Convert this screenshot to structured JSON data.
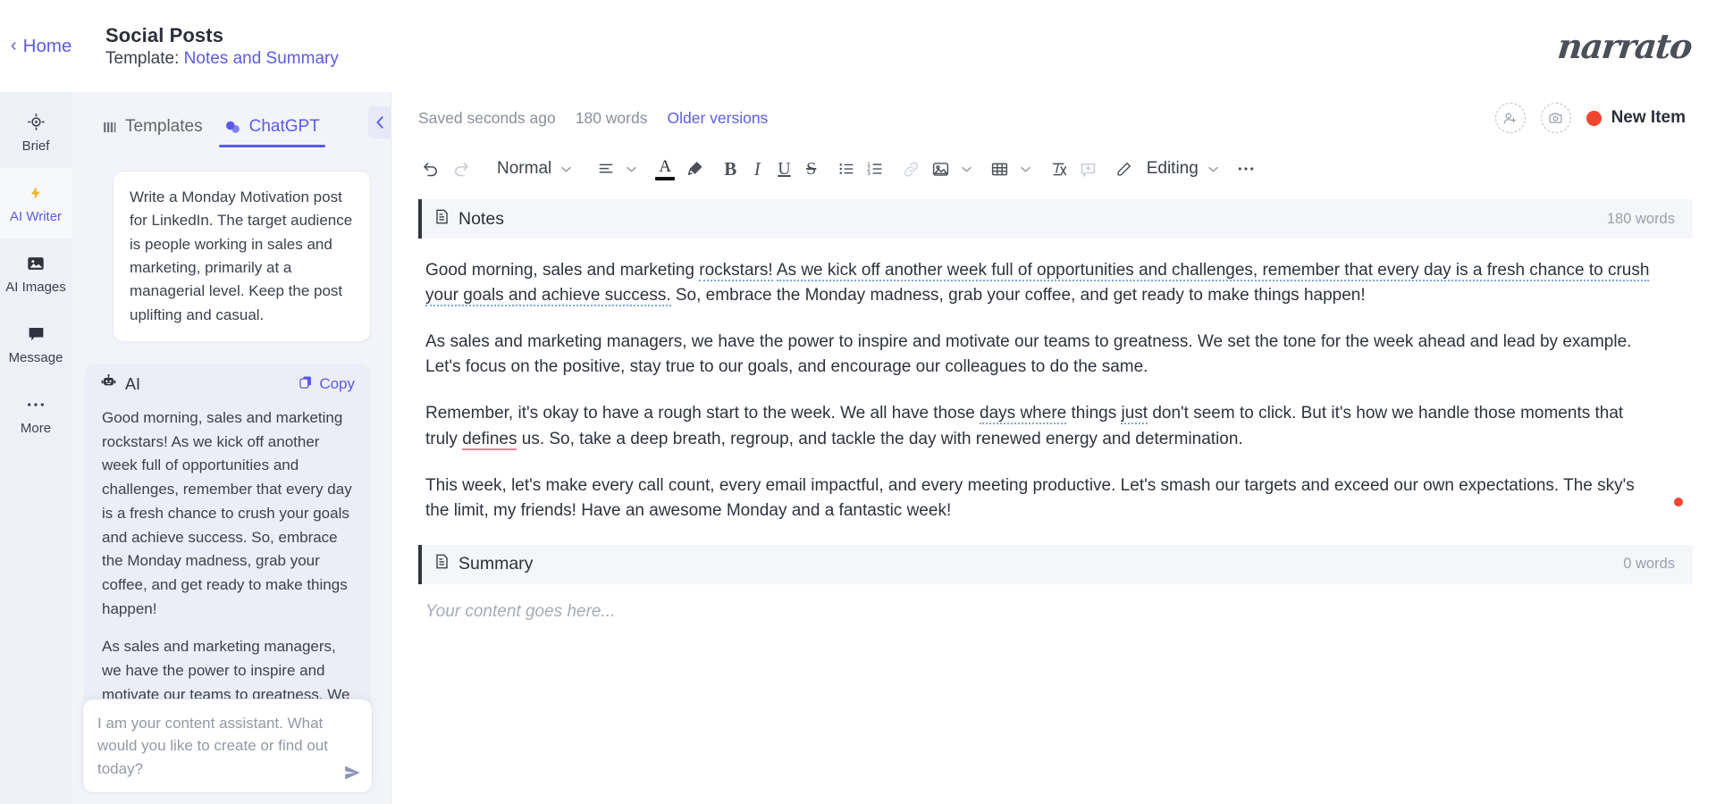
{
  "header": {
    "home_label": "Home",
    "doc_title": "Social Posts",
    "template_prefix": "Template:",
    "template_name": "Notes and Summary",
    "brand": "narrato"
  },
  "rail": {
    "items": [
      {
        "label": "Brief",
        "icon": "target-icon",
        "active": false
      },
      {
        "label": "AI Writer",
        "icon": "lightning-icon",
        "active": true
      },
      {
        "label": "AI Images",
        "icon": "image-icon",
        "active": false
      },
      {
        "label": "Message",
        "icon": "chat-bubble-icon",
        "active": false
      },
      {
        "label": "More",
        "icon": "ellipsis-icon",
        "active": false
      }
    ]
  },
  "panel": {
    "tabs": [
      {
        "label": "Templates",
        "icon": "templates-icon",
        "active": false
      },
      {
        "label": "ChatGPT",
        "icon": "chat-dots-icon",
        "active": true
      }
    ],
    "user_prompt": "Write a Monday Motivation post for LinkedIn. The target audience is people working in sales and marketing, primarily at a managerial level. Keep the post uplifting and casual.",
    "ai_label": "AI",
    "copy_label": "Copy",
    "ai_response_paragraphs": [
      "Good morning, sales and marketing rockstars! As we kick off another week full of opportunities and challenges, remember that every day is a fresh chance to crush your goals and achieve success. So, embrace the Monday madness, grab your coffee, and get ready to make things happen!",
      "As sales and marketing managers, we have the power to inspire and motivate our teams to greatness. We set the tone for the week ahead and lead by example."
    ],
    "chat_placeholder": "I am your content assistant. What would you like to create or find out today?"
  },
  "editor": {
    "saved_status": "Saved seconds ago",
    "word_count": "180 words",
    "older_versions": "Older versions",
    "new_item_label": "New Item",
    "new_item_dot_color": "#f0452e",
    "toolbar": {
      "style_label": "Normal",
      "editing_label": "Editing"
    },
    "sections": [
      {
        "title": "Notes",
        "words": "180 words",
        "paragraphs": [
          [
            {
              "t": "Good morning, sales and marketing ",
              "u": "none"
            },
            {
              "t": "rockstars!",
              "u": "blue"
            },
            {
              "t": " ",
              "u": "none"
            },
            {
              "t": "As we kick off another week full of opportunities and challenges, remember that every day is a fresh chance to crush your goals and achieve success.",
              "u": "blue"
            },
            {
              "t": " So, embrace the Monday madness, grab your coffee, and get ready to make things happen!",
              "u": "none"
            }
          ],
          [
            {
              "t": "As sales and marketing managers, we have the power to inspire and motivate our teams to greatness. We set the tone for the week ahead and lead by example. Let's focus on the positive, stay true to our goals, and encourage our colleagues to do the same.",
              "u": "none"
            }
          ],
          [
            {
              "t": "Remember, it's okay to have a rough start to the week. We all have those ",
              "u": "none"
            },
            {
              "t": "days where",
              "u": "blue"
            },
            {
              "t": " things ",
              "u": "none"
            },
            {
              "t": "just",
              "u": "blue"
            },
            {
              "t": " don't seem to click. But it's how we handle those moments that truly ",
              "u": "none"
            },
            {
              "t": "defines",
              "u": "red"
            },
            {
              "t": " us. So, take a deep breath, regroup, and tackle the day with renewed energy and determination.",
              "u": "none"
            }
          ],
          [
            {
              "t": "This week, let's make every call count, every email impactful, and every meeting productive. Let's smash our targets and exceed our own expectations. The sky's the limit, my friends! Have an awesome Monday and a fantastic week!",
              "u": "none"
            }
          ]
        ]
      },
      {
        "title": "Summary",
        "words": "0 words",
        "placeholder": "Your content goes here..."
      }
    ]
  }
}
